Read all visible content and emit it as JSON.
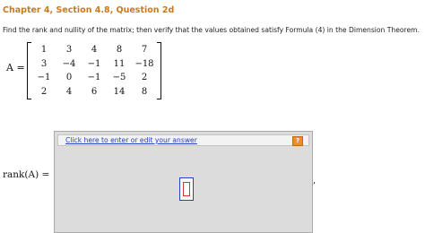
{
  "question": {
    "title": "Chapter 4, Section 4.8, Question 2d",
    "prompt": "Find the rank and nullity of the matrix; then verify that the values obtained satisfy Formula (4) in the Dimension Theorem.",
    "matrix_label": "A =",
    "matrix": [
      [
        "1",
        "3",
        "4",
        "8",
        "7"
      ],
      [
        "3",
        "−4",
        "−1",
        "11",
        "−18"
      ],
      [
        "−1",
        "0",
        "−1",
        "−5",
        "2"
      ],
      [
        "2",
        "4",
        "6",
        "14",
        "8"
      ]
    ]
  },
  "answer": {
    "label": "rank(A) =",
    "link_text": "Click here to enter or edit your answer",
    "help_label": "?",
    "trailing_text": ","
  }
}
